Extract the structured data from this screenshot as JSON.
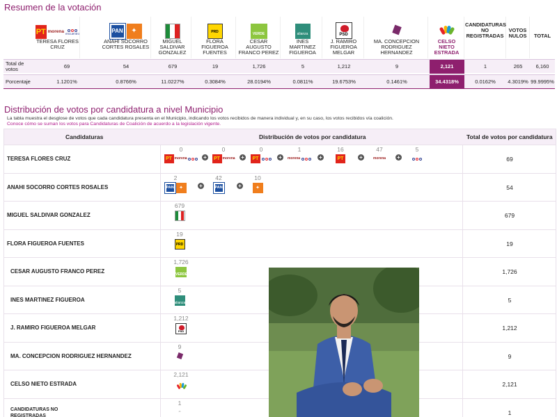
{
  "summary": {
    "title": "Resumen de la votación",
    "rows": {
      "total_label": "Total de votos",
      "pct_label": "Porcentaje"
    },
    "columns": [
      {
        "name": "TERESA FLORES CRUZ",
        "total": "69",
        "pct": "1.1201%"
      },
      {
        "name": "ANAHI SOCORRO CORTES ROSALES",
        "total": "54",
        "pct": "0.8766%"
      },
      {
        "name": "MIGUEL SALDIVAR GONZALEZ",
        "total": "679",
        "pct": "11.0227%"
      },
      {
        "name": "FLORA FIGUEROA FUENTES",
        "total": "19",
        "pct": "0.3084%"
      },
      {
        "name": "CESAR AUGUSTO FRANCO PEREZ",
        "total": "1,726",
        "pct": "28.0194%"
      },
      {
        "name": "INES MARTINEZ FIGUEROA",
        "total": "5",
        "pct": "0.0811%"
      },
      {
        "name": "J. RAMIRO FIGUEROA MELGAR",
        "total": "1,212",
        "pct": "19.6753%"
      },
      {
        "name": "MA. CONCEPCION RODRIGUEZ HERNANDEZ",
        "total": "9",
        "pct": "0.1461%"
      },
      {
        "name": "CELSO NIETO ESTRADA",
        "total": "2,121",
        "pct": "34.4318%"
      },
      {
        "name": "CANDIDATURAS NO REGISTRADAS",
        "total": "1",
        "pct": "0.0162%"
      },
      {
        "name": "VOTOS NULOS",
        "total": "265",
        "pct": "4.3019%"
      },
      {
        "name": "TOTAL",
        "total": "6,160",
        "pct": "99.9995%"
      }
    ],
    "highlight_color": "#8e1f6e"
  },
  "distribution": {
    "title": "Distribución de votos por candidatura a nivel Municipio",
    "desc": "La tabla muestra el desglose de votos que cada candidatura presenta en el Municipio, indicando los votos recibidos de manera individual y, en su caso, los votos recibidos vía coalición.",
    "link": "Conoce cómo se suman los votos para Candidaturas de Coalición de acuerdo a la legislación vigente.",
    "headers": {
      "c1": "Candidaturas",
      "c2": "Distribución de votos por candidatura",
      "c3": "Total de votos por candidatura"
    },
    "rows": [
      {
        "name": "TERESA FLORES CRUZ",
        "total": "69",
        "cells": [
          "0",
          "0",
          "0",
          "1",
          "16",
          "47",
          "5"
        ]
      },
      {
        "name": "ANAHI SOCORRO CORTES ROSALES",
        "total": "54",
        "cells": [
          "2",
          "42",
          "10"
        ]
      },
      {
        "name": "MIGUEL SALDIVAR GONZALEZ",
        "total": "679",
        "cells": [
          "679"
        ]
      },
      {
        "name": "FLORA FIGUEROA FUENTES",
        "total": "19",
        "cells": [
          "19"
        ]
      },
      {
        "name": "CESAR AUGUSTO FRANCO PEREZ",
        "total": "1,726",
        "cells": [
          "1,726"
        ]
      },
      {
        "name": "INES MARTINEZ FIGUEROA",
        "total": "5",
        "cells": [
          "5"
        ]
      },
      {
        "name": "J. RAMIRO FIGUEROA MELGAR",
        "total": "1,212",
        "cells": [
          "1,212"
        ]
      },
      {
        "name": "MA. CONCEPCION RODRIGUEZ HERNANDEZ",
        "total": "9",
        "cells": [
          "9"
        ]
      },
      {
        "name": "CELSO NIETO ESTRADA",
        "total": "2,121",
        "cells": [
          "2,121"
        ]
      },
      {
        "name": "CANDIDATURAS NO REGISTRADAS",
        "total": "1",
        "cells": [
          "1"
        ]
      }
    ]
  },
  "logos": {
    "pt": "PT",
    "morena": "morena",
    "encuentro": "encuentro",
    "pan": "PAN",
    "mc": "MC",
    "prd": "PRD",
    "verde": "VERDE",
    "alianza": "alianza",
    "psd": "PSD"
  }
}
